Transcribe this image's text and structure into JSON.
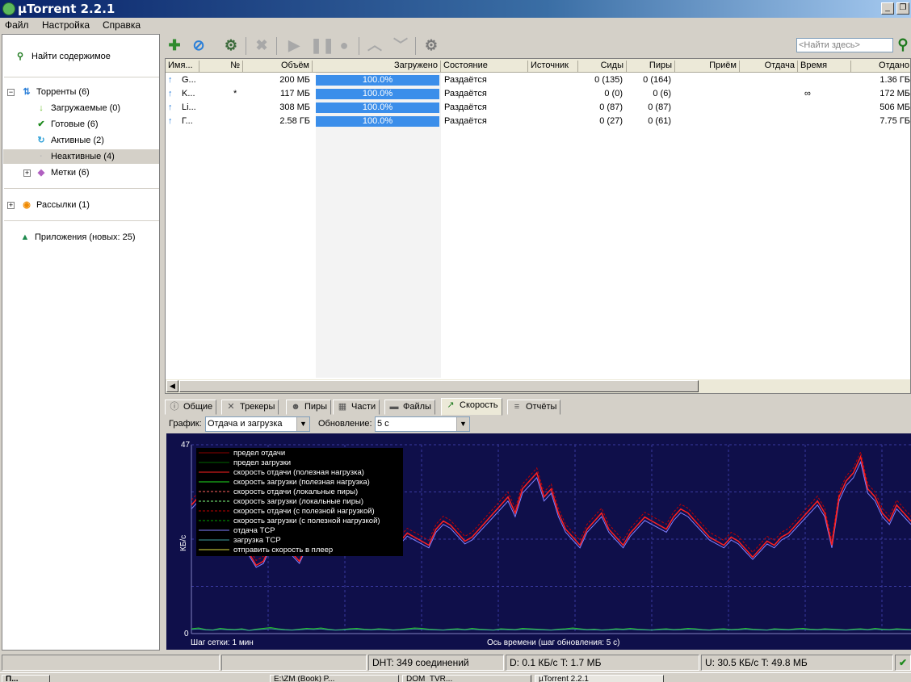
{
  "window": {
    "title": "µTorrent 2.2.1",
    "minimize_glyph": "_",
    "restore_glyph": "❐"
  },
  "menu": [
    "Файл",
    "Настройка",
    "Справка"
  ],
  "sidebar": {
    "find_label": "Найти содержимое",
    "torrents": "Торренты (6)",
    "downloading": "Загружаемые (0)",
    "completed": "Готовые (6)",
    "active": "Активные (2)",
    "inactive": "Неактивные (4)",
    "labels": "Метки (6)",
    "feeds": "Рассылки (1)",
    "apps": "Приложения (новых: 25)"
  },
  "toolbar": {
    "search_placeholder": "<Найти здесь>"
  },
  "columns": [
    "Имя...",
    "№",
    "Объём",
    "Загружено",
    "Состояние",
    "Источник",
    "Сиды",
    "Пиры",
    "Приём",
    "Отдача",
    "Время",
    "Отдано"
  ],
  "torrents": [
    {
      "name": "G...",
      "num": "",
      "size": "200 МБ",
      "progress_label": "100.0%",
      "progress": 1.0,
      "status": "Раздаётся",
      "seeds": "0 (135)",
      "peers": "0 (164)",
      "eta": "",
      "uploaded": "1.36 ГБ"
    },
    {
      "name": "K...",
      "num": "*",
      "size": "117 МБ",
      "progress_label": "100.0%",
      "progress": 1.0,
      "status": "Раздаётся",
      "seeds": "0 (0)",
      "peers": "0 (6)",
      "eta": "∞",
      "uploaded": "172 МБ"
    },
    {
      "name": "Li...",
      "num": "",
      "size": "308 МБ",
      "progress_label": "100.0%",
      "progress": 1.0,
      "status": "Раздаётся",
      "seeds": "0 (87)",
      "peers": "0 (87)",
      "eta": "",
      "uploaded": "506 МБ"
    },
    {
      "name": "Г...",
      "num": "",
      "size": "2.58 ГБ",
      "progress_label": "100.0%",
      "progress": 1.0,
      "status": "Раздаётся",
      "seeds": "0 (27)",
      "peers": "0 (61)",
      "eta": "",
      "uploaded": "7.75 ГБ"
    }
  ],
  "tabs": [
    "Общие",
    "Трекеры",
    "Пиры",
    "Части",
    "Файлы",
    "Скорость",
    "Отчёты"
  ],
  "graph_controls": {
    "graph_label": "График:",
    "graph_value": "Отдача и загрузка",
    "update_label": "Обновление:",
    "update_value": "5 с"
  },
  "chart_data": {
    "type": "line",
    "ylabel": "КБ/с",
    "ymax_label": "47",
    "ymin_label": "0",
    "ylim": [
      0,
      47
    ],
    "xlabel": "Ось времени (шаг обновления: 5 с)",
    "grid_step_label": "Шаг сетки: 1 мин",
    "legend": [
      {
        "name": "предел отдачи",
        "color": "#8b0000",
        "dash": false
      },
      {
        "name": "предел загрузки",
        "color": "#006400",
        "dash": false
      },
      {
        "name": "скорость отдачи (полезная нагрузка)",
        "color": "#ff2020",
        "dash": false
      },
      {
        "name": "скорость загрузки (полезная нагрузка)",
        "color": "#20e020",
        "dash": false
      },
      {
        "name": "скорость отдачи (локальные пиры)",
        "color": "#ff6060",
        "dash": true
      },
      {
        "name": "скорость загрузки (локальные пиры)",
        "color": "#80ff80",
        "dash": true
      },
      {
        "name": "скорость отдачи (с полезной нагрузкой)",
        "color": "#c00000",
        "dash": true
      },
      {
        "name": "скорость загрузки (с полезной нагрузкой)",
        "color": "#00a000",
        "dash": true
      },
      {
        "name": "отдача TCP",
        "color": "#8080ff",
        "dash": false
      },
      {
        "name": "загрузка TCP",
        "color": "#40a0a0",
        "dash": false
      },
      {
        "name": "отправить скорость в плеер",
        "color": "#e0e040",
        "dash": false
      }
    ],
    "upload_series": [
      32,
      34,
      33,
      31,
      30,
      28,
      26,
      24,
      20,
      17,
      18,
      22,
      26,
      24,
      20,
      18,
      22,
      25,
      28,
      30,
      32,
      31,
      29,
      27,
      28,
      30,
      28,
      26,
      24,
      23,
      25,
      24,
      23,
      22,
      26,
      28,
      27,
      25,
      23,
      24,
      26,
      28,
      30,
      32,
      34,
      30,
      36,
      38,
      40,
      34,
      36,
      30,
      26,
      24,
      22,
      26,
      28,
      30,
      26,
      24,
      22,
      25,
      27,
      29,
      28,
      27,
      26,
      29,
      31,
      30,
      28,
      26,
      24,
      23,
      22,
      24,
      23,
      21,
      19,
      21,
      23,
      22,
      24,
      25,
      27,
      29,
      31,
      33,
      30,
      22,
      34,
      38,
      40,
      44,
      36,
      34,
      30,
      28,
      32,
      30,
      28
    ],
    "download_series": [
      1.2,
      1.4,
      1.0,
      0.9,
      1.3,
      1.1,
      1.0,
      1.2,
      0.8,
      1.1,
      1.3,
      1.5,
      1.2,
      1.0,
      0.9,
      1.1,
      1.3,
      1.2,
      1.4,
      1.1,
      0.9,
      1.0,
      1.2,
      1.3,
      1.1,
      1.0,
      1.2,
      1.1,
      0.9,
      1.0,
      1.2,
      1.4,
      1.3,
      1.1,
      1.0,
      0.9,
      1.1,
      1.2,
      1.0,
      1.3,
      1.1,
      1.0,
      0.9,
      1.2,
      1.1,
      1.0,
      1.3,
      1.2,
      1.1,
      1.0,
      0.9,
      1.1,
      1.2,
      1.4,
      1.2,
      1.0,
      1.1,
      0.9,
      1.0,
      1.2,
      1.1,
      1.3,
      1.1,
      1.0,
      0.9,
      1.1,
      1.2,
      1.0,
      1.1,
      1.3,
      1.2,
      1.0,
      0.9,
      1.1,
      1.2,
      1.0,
      1.1,
      1.3,
      1.1,
      1.0,
      0.9,
      1.2,
      1.1,
      1.0,
      1.2,
      1.3,
      1.1,
      1.0,
      1.2,
      1.1,
      1.0,
      0.9,
      1.1,
      1.2,
      1.0,
      1.3,
      1.1,
      1.0,
      1.2,
      1.1,
      1.0
    ]
  },
  "statusbar": {
    "dht": "DHT: 349 соединений",
    "download": "D: 0.1 КБ/с T: 1.7 МБ",
    "upload": "U: 30.5 КБ/с T: 49.8 МБ"
  },
  "taskbar": [
    "П...",
    "E:\\ZM (Book) P...",
    "DOM_TVR...",
    "µTorrent 2.2.1"
  ]
}
